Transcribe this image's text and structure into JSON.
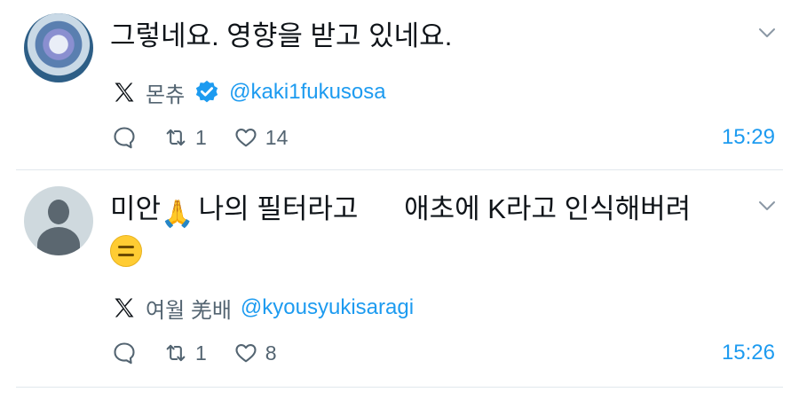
{
  "tweets": [
    {
      "text": "그렇네요. 영향을 받고 있네요.",
      "author_name": "몬츄",
      "handle": "@kaki1fukusosa",
      "verified": true,
      "retweets": "1",
      "likes": "14",
      "time": "15:29"
    },
    {
      "text_part1": "미안",
      "text_part2": " 나의 필터라고      애초에 K라고 인식해버려",
      "emoji_1": "folded-hands",
      "emoji_2": "expressionless-face",
      "author_name": "여월 羌배",
      "handle": "@kyousyukisaragi",
      "verified": false,
      "retweets": "1",
      "likes": "8",
      "time": "15:26"
    }
  ],
  "colors": {
    "accent": "#1d9bf0",
    "muted": "#536471",
    "divider": "#e1e8ed"
  },
  "icons": [
    "chevron-down-icon",
    "x-logo-icon",
    "verified-badge-icon",
    "reply-icon",
    "retweet-icon",
    "like-icon"
  ]
}
